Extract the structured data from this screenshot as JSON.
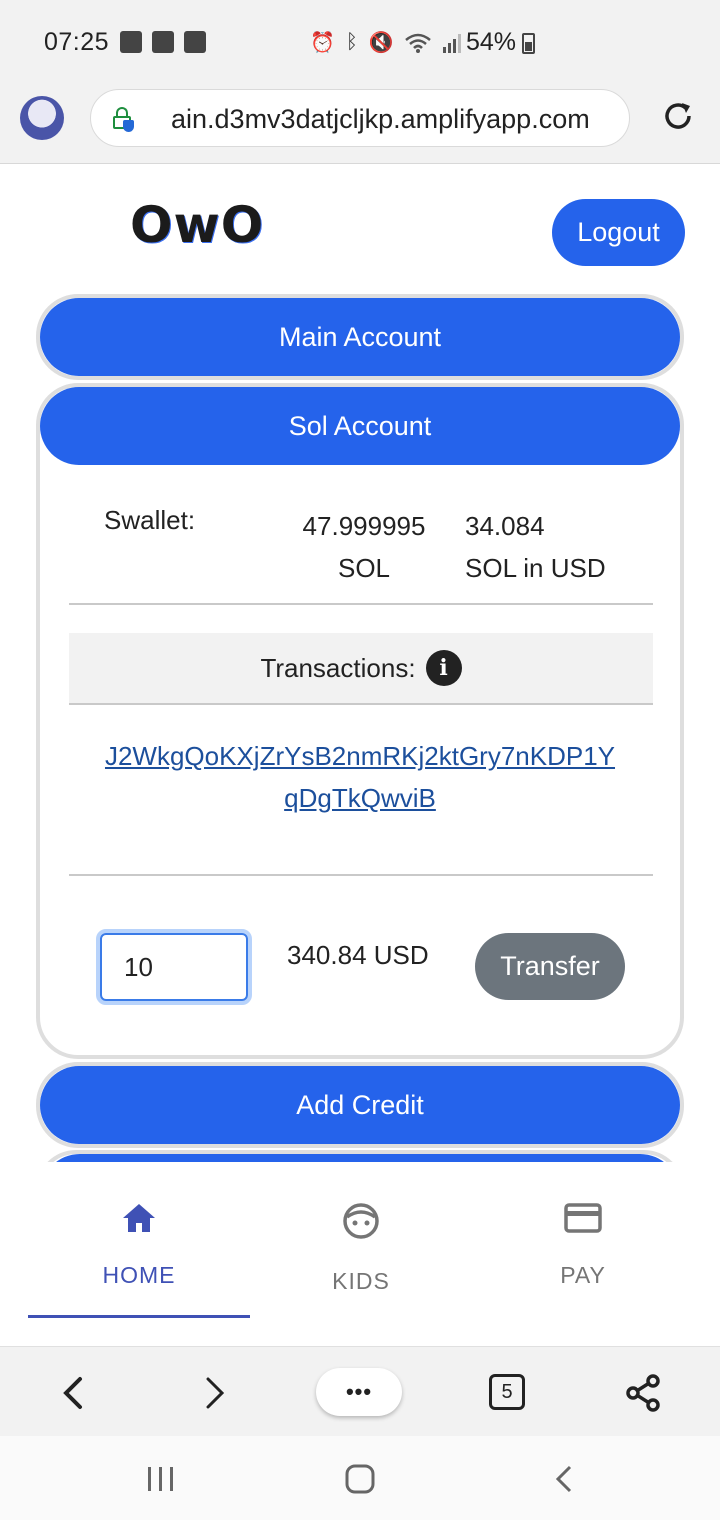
{
  "status_bar": {
    "time": "07:25",
    "battery": "54%",
    "icons_left": [
      "image-icon",
      "sd-card-icon",
      "sigma-icon"
    ],
    "icons_right": [
      "alarm-icon",
      "bluetooth-icon",
      "mute-icon",
      "wifi-icon",
      "signal-icon"
    ]
  },
  "browser": {
    "url": "ain.d3mv3datjcljkp.amplifyapp.com",
    "tab_count": "5",
    "more_label": "•••"
  },
  "header": {
    "logo_text": "OwO",
    "logout_label": "Logout"
  },
  "accordion": {
    "main_account": "Main Account",
    "sol_account": "Sol Account",
    "add_credit": "Add Credit"
  },
  "sol_account": {
    "wallet_label": "Swallet:",
    "sol_amount": "47.999995",
    "sol_unit": "SOL",
    "usd_amount": "34.084",
    "usd_unit": "SOL in USD",
    "transactions_label": "Transactions:",
    "transaction_link": "J2WkgQoKXjZrYsB2nmRKj2ktGry7nKDP1YqDgTkQwviB",
    "transfer_amount": "10",
    "transfer_usd": "340.84 USD",
    "transfer_label": "Transfer"
  },
  "bottom_nav": {
    "items": [
      {
        "label": "HOME",
        "icon": "home-icon",
        "active": true
      },
      {
        "label": "KIDS",
        "icon": "face-icon",
        "active": false
      },
      {
        "label": "PAY",
        "icon": "credit-card-icon",
        "active": false
      }
    ]
  },
  "colors": {
    "primary": "#2563eb",
    "nav_active": "#3f51b5",
    "secondary_button": "#6c757d",
    "link": "#1c4f9c"
  }
}
